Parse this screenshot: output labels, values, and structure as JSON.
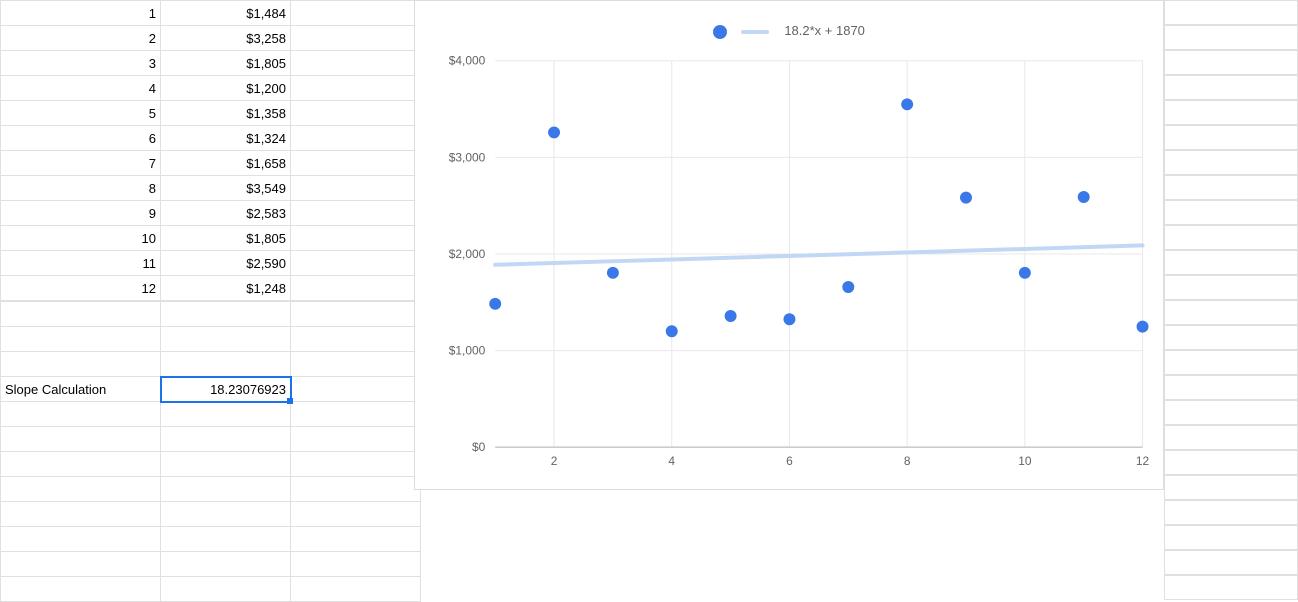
{
  "table": {
    "rows": [
      {
        "idx": "1",
        "val": "$1,484"
      },
      {
        "idx": "2",
        "val": "$3,258"
      },
      {
        "idx": "3",
        "val": "$1,805"
      },
      {
        "idx": "4",
        "val": "$1,200"
      },
      {
        "idx": "5",
        "val": "$1,358"
      },
      {
        "idx": "6",
        "val": "$1,324"
      },
      {
        "idx": "7",
        "val": "$1,658"
      },
      {
        "idx": "8",
        "val": "$3,549"
      },
      {
        "idx": "9",
        "val": "$2,583"
      },
      {
        "idx": "10",
        "val": "$1,805"
      },
      {
        "idx": "11",
        "val": "$2,590"
      },
      {
        "idx": "12",
        "val": "$1,248"
      }
    ]
  },
  "slope": {
    "label": "Slope Calculation",
    "value": "18.23076923"
  },
  "legend_text": "18.2*x + 1870",
  "chart_data": {
    "type": "scatter",
    "x": [
      1,
      2,
      3,
      4,
      5,
      6,
      7,
      8,
      9,
      10,
      11,
      12
    ],
    "y": [
      1484,
      3258,
      1805,
      1200,
      1358,
      1324,
      1658,
      3549,
      2583,
      1805,
      2590,
      1248
    ],
    "trendline": {
      "slope": 18.2,
      "intercept": 1870,
      "label": "18.2*x + 1870"
    },
    "xlabel": "",
    "ylabel": "",
    "x_ticks": [
      "2",
      "4",
      "6",
      "8",
      "10",
      "12"
    ],
    "y_ticks": [
      "$0",
      "$1,000",
      "$2,000",
      "$3,000",
      "$4,000"
    ],
    "xlim": [
      1,
      12
    ],
    "ylim": [
      0,
      4000
    ]
  }
}
